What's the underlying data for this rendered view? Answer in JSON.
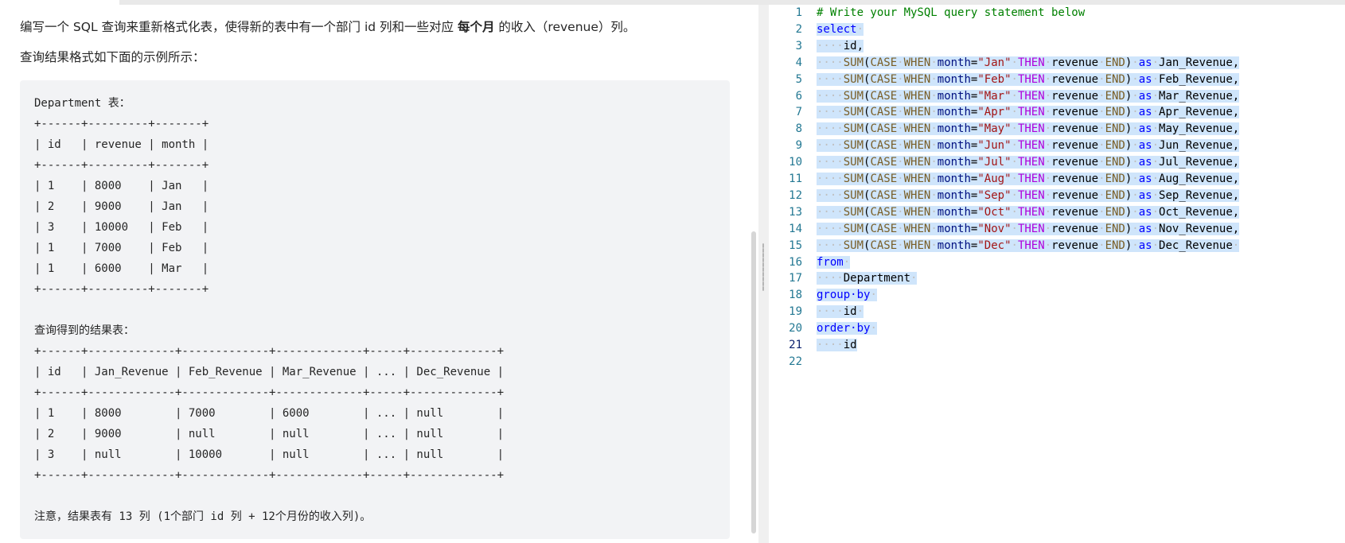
{
  "problem": {
    "intro_before_bold": "编写一个 SQL 查询来重新格式化表，使得新的表中有一个部门 id 列和一些对应 ",
    "intro_bold": "每个月",
    "intro_after_bold": " 的收入（revenue）列。",
    "format_hint": "查询结果格式如下面的示例所示：",
    "example_lines": [
      "Department 表：",
      "+------+---------+-------+",
      "| id   | revenue | month |",
      "+------+---------+-------+",
      "| 1    | 8000    | Jan   |",
      "| 2    | 9000    | Jan   |",
      "| 3    | 10000   | Feb   |",
      "| 1    | 7000    | Feb   |",
      "| 1    | 6000    | Mar   |",
      "+------+---------+-------+",
      "",
      "查询得到的结果表：",
      "+------+-------------+-------------+-------------+-----+-------------+",
      "| id   | Jan_Revenue | Feb_Revenue | Mar_Revenue | ... | Dec_Revenue |",
      "+------+-------------+-------------+-------------+-----+-------------+",
      "| 1    | 8000        | 7000        | 6000        | ... | null        |",
      "| 2    | 9000        | null        | null        | ... | null        |",
      "| 3    | null        | 10000       | null        | ... | null        |",
      "+------+-------------+-------------+-------------+-----+-------------+",
      "",
      "注意，结果表有 13 列 (1个部门 id 列 + 12个月份的收入列)。"
    ]
  },
  "editor": {
    "line_numbers": [
      "1",
      "2",
      "3",
      "4",
      "5",
      "6",
      "7",
      "8",
      "9",
      "10",
      "11",
      "12",
      "13",
      "14",
      "15",
      "16",
      "17",
      "18",
      "19",
      "20",
      "21",
      "22"
    ],
    "active_line": "21",
    "comment": "# Write your MySQL query statement below",
    "kw_select": "select",
    "id_col": "id,",
    "months": [
      "Jan",
      "Feb",
      "Mar",
      "Apr",
      "May",
      "Jun",
      "Jul",
      "Aug",
      "Sep",
      "Oct",
      "Nov",
      "Dec"
    ],
    "tok_sum": "SUM",
    "tok_case": "CASE",
    "tok_when": "WHEN",
    "tok_month": "month",
    "tok_then": "THEN",
    "tok_revenue": "revenue",
    "tok_end": "END",
    "tok_as": "as",
    "kw_from": "from",
    "table_name": "Department",
    "kw_group_by": "group by",
    "group_col": "id",
    "kw_order_by": "order by",
    "order_col": "id",
    "colors": {
      "comment": "#008000",
      "keyword": "#0000ff",
      "function": "#795e26",
      "string": "#a31515",
      "then": "#af00db",
      "selection": "#cfe5fb",
      "line_number": "#237893"
    }
  }
}
